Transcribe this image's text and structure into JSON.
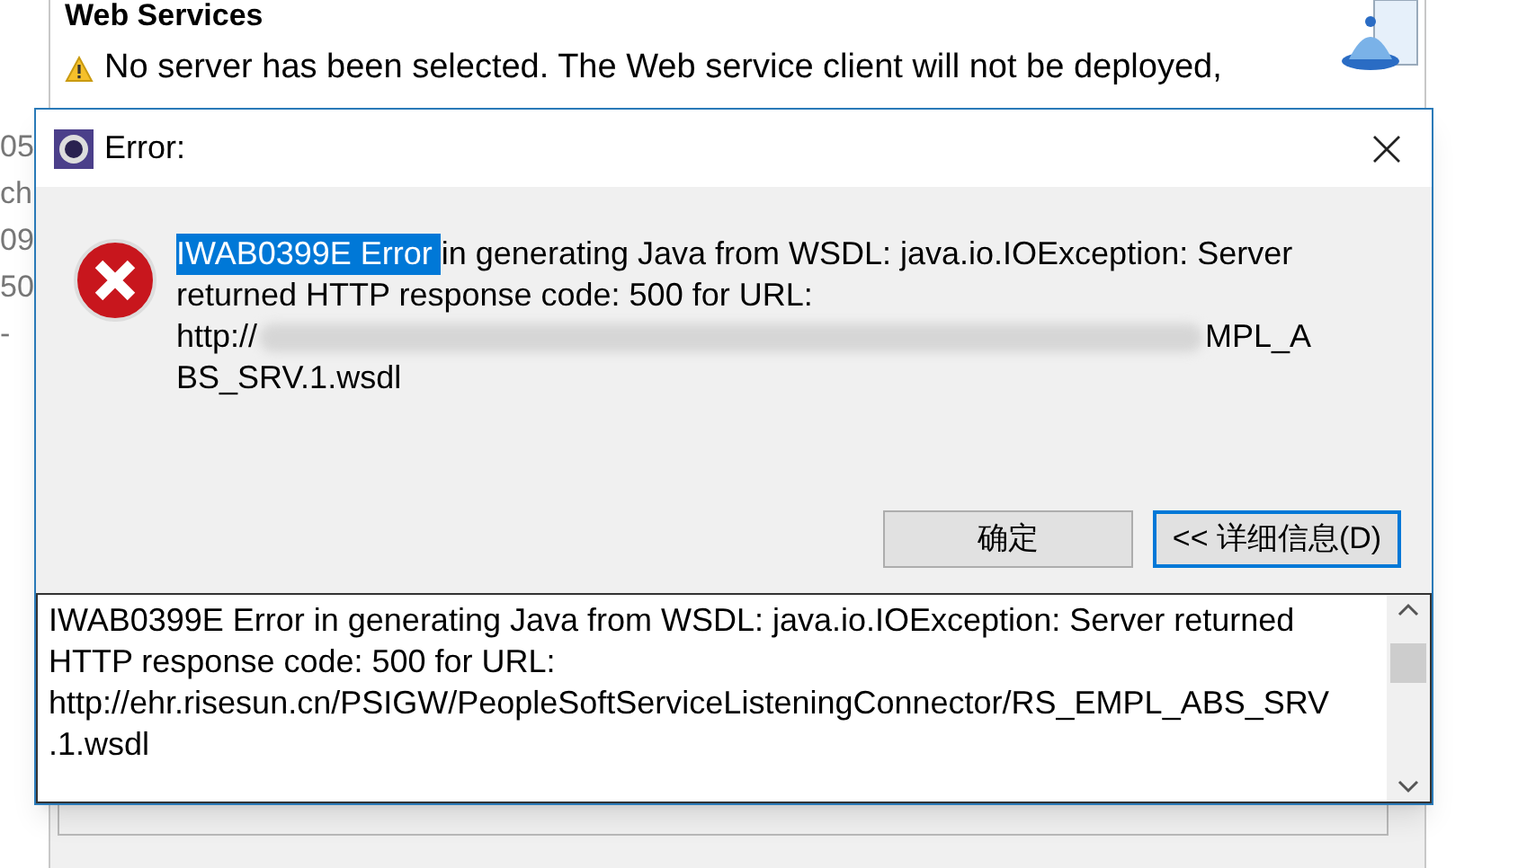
{
  "background_window": {
    "header": "Web Services",
    "warning": "No server has been selected. The Web service client will not be deployed,",
    "left_fragments": [
      "05",
      "ch",
      "09",
      "50",
      "-"
    ]
  },
  "dialog": {
    "title": "Error:",
    "message": {
      "highlighted": "IWAB0399E Error",
      "lines": [
        "in generating Java from WSDL:  java.io.IOException: Server",
        "returned HTTP response code: 500 for URL:"
      ],
      "url_start": "http://",
      "url_end": "MPL_A",
      "last_line": "BS_SRV.1.wsdl"
    },
    "buttons": [
      {
        "label": "确定",
        "selected": false
      },
      {
        "label": "<< 详细信息(D)",
        "selected": true
      }
    ],
    "details": "IWAB0399E Error in generating Java from WSDL:  java.io.IOException: Server returned HTTP response code: 500 for URL: http://ehr.risesun.cn/PSIGW/PeopleSoftServiceListeningConnector/RS_EMPL_ABS_SRV .1.wsdl"
  }
}
